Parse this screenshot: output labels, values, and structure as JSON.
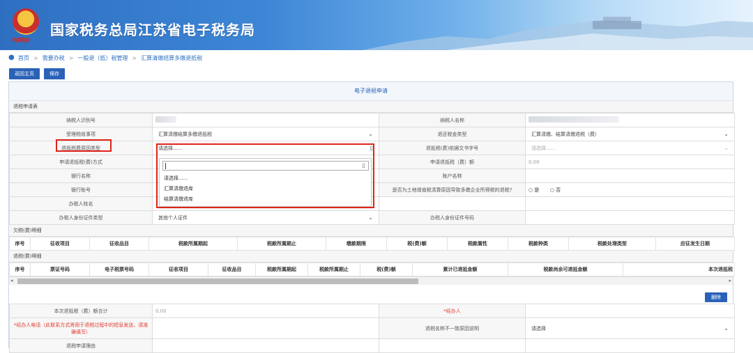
{
  "header": {
    "title": "国家税务总局江苏省电子税务局",
    "emblem_sub": "中国税务"
  },
  "breadcrumb": {
    "home": "首页",
    "items": [
      "我要办税",
      "一般退（抵）税管理",
      "汇算清缴结算多缴退抵税"
    ],
    "sep": ">"
  },
  "toolbar": {
    "back_label": "返回主页",
    "save_label": "保存"
  },
  "panel": {
    "title": "电子退税申请",
    "section_apply": "退税申请表",
    "fields": {
      "taxpayer_id_label": "纳税人识别号",
      "taxpayer_name_label": "纳税人名称",
      "accept_matter_label": "受理税收事项",
      "accept_matter_value": "汇算清缴结算多缴退抵税",
      "refund_type_label": "退还税金类型",
      "refund_type_value": "汇算清缴、结算清缴退税（费）",
      "reason_type_label": "退抵税费原因类型",
      "reason_type_value": "请选择......",
      "doc_no_label": "退抵税(费)依据文书字号",
      "doc_no_value": "请选择......",
      "method_label": "申请退抵税(费)方式",
      "amount_label": "申请退抵税（费）额",
      "amount_value": "0.00",
      "bank_label": "银行名称",
      "account_name_label": "账户名称",
      "account_no_label": "银行账号",
      "land_vat_label": "是否为土地增值税清算原因导致多缴企业所得税的退税?",
      "yes_label": "是",
      "no_label": "否",
      "handler_name_label": "办税人姓名",
      "handler_idtype_label": "办税人身份证件类型",
      "handler_idtype_value": "其他个人证件",
      "handler_idno_label": "办税人身份证件号码"
    },
    "dropdown_options": [
      "请选择......",
      "汇算清缴退库",
      "结算清缴退库"
    ],
    "section_arrears": "欠税(费)明细",
    "arrears_columns": [
      "序号",
      "征收项目",
      "征收品目",
      "税款所属期起",
      "税款所属期止",
      "缴款期限",
      "税(费)额",
      "税款属性",
      "税款种类",
      "税款处理类型",
      "应征发生日期"
    ],
    "section_refund": "退税(费)明细",
    "refund_columns": [
      "序号",
      "票证号码",
      "电子税票号码",
      "征收项目",
      "征收品目",
      "税款所属期起",
      "税款所属期止",
      "税(费)额",
      "累计已退抵金额",
      "税款尚余可退抵金额",
      "本次退抵税"
    ],
    "delete_label": "删除",
    "bottom": {
      "total_label": "本次退抵税（费）额合计",
      "total_value": "0.00",
      "handler_label": "*经办人",
      "phone_label": "*经办人电话（此联系方式将用于退税过程中的短息发送，请准确填写）",
      "mismatch_label": "退税名称不一致原因说明",
      "mismatch_value": "请选择",
      "reason_cut": "退税申请理由"
    }
  },
  "colors": {
    "accent": "#2a62b8",
    "highlight": "#e02418",
    "banner": "#3d86d6"
  },
  "icons": [
    "location-pin-icon",
    "chevron-down-icon",
    "search-icon",
    "scroll-left-icon",
    "scroll-right-icon"
  ]
}
